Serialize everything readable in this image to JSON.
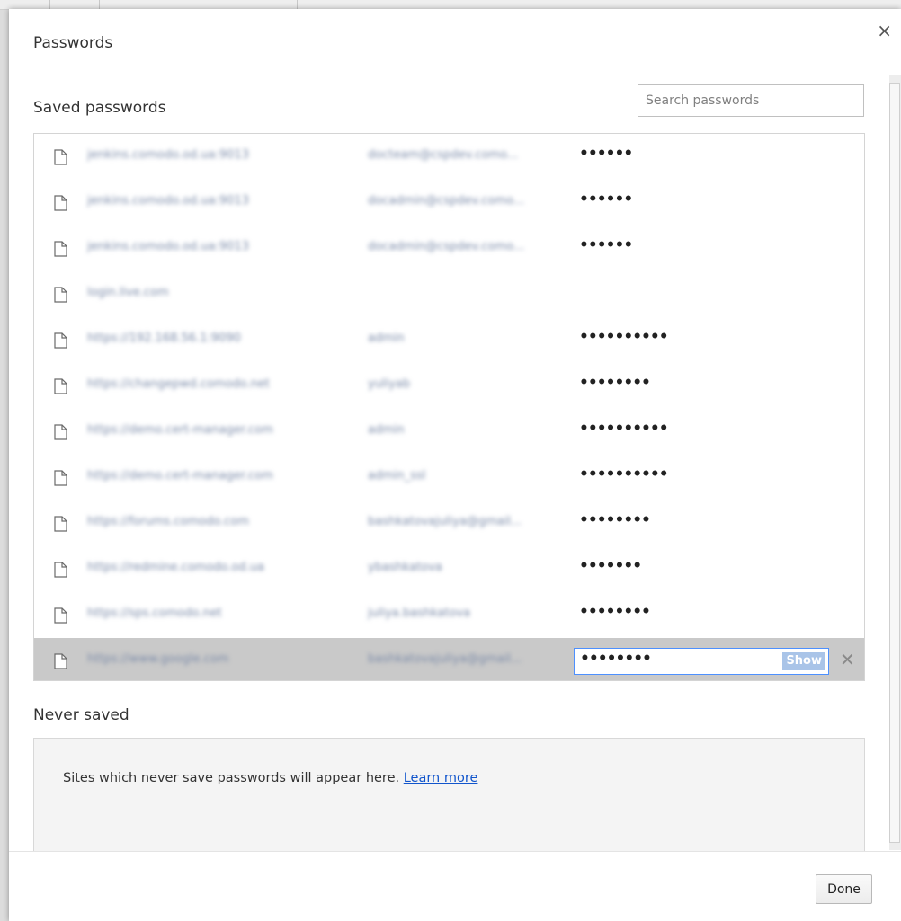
{
  "dialog": {
    "title": "Passwords",
    "close_glyph": "×"
  },
  "saved": {
    "label": "Saved passwords",
    "search_placeholder": "Search passwords",
    "rows": [
      {
        "site": "jenkins.comodo.od.ua:9013",
        "user": "docteam@cspdev.como...",
        "password": "••••••"
      },
      {
        "site": "jenkins.comodo.od.ua:9013",
        "user": "docadmin@cspdev.como...",
        "password": "••••••"
      },
      {
        "site": "jenkins.comodo.od.ua:9013",
        "user": "docadmin@cspdev.como...",
        "password": "••••••"
      },
      {
        "site": "login.live.com",
        "user": "",
        "password": ""
      },
      {
        "site": "https://192.168.56.1:9090",
        "user": "admin",
        "password": "••••••••••"
      },
      {
        "site": "https://changepwd.comodo.net",
        "user": "yuliyab",
        "password": "••••••••"
      },
      {
        "site": "https://demo.cert-manager.com",
        "user": "admin",
        "password": "••••••••••"
      },
      {
        "site": "https://demo.cert-manager.com",
        "user": "admin_ssl",
        "password": "••••••••••"
      },
      {
        "site": "https://forums.comodo.com",
        "user": "bashkatovajuliya@gmail...",
        "password": "••••••••"
      },
      {
        "site": "https://redmine.comodo.od.ua",
        "user": "ybashkatova",
        "password": "•••••••"
      },
      {
        "site": "https://sps.comodo.net",
        "user": "juliya.bashkatova",
        "password": "••••••••"
      },
      {
        "site": "https://www.google.com",
        "user": "bashkatovajuliya@gmail...",
        "password": "••••••••",
        "selected": true
      }
    ],
    "show_label": "Show",
    "remove_glyph": "✕"
  },
  "never": {
    "label": "Never saved",
    "message": "Sites which never save passwords will appear here.",
    "learn_more": "Learn more"
  },
  "footer": {
    "done_label": "Done"
  },
  "icons": {
    "row_icon": "document-icon"
  }
}
